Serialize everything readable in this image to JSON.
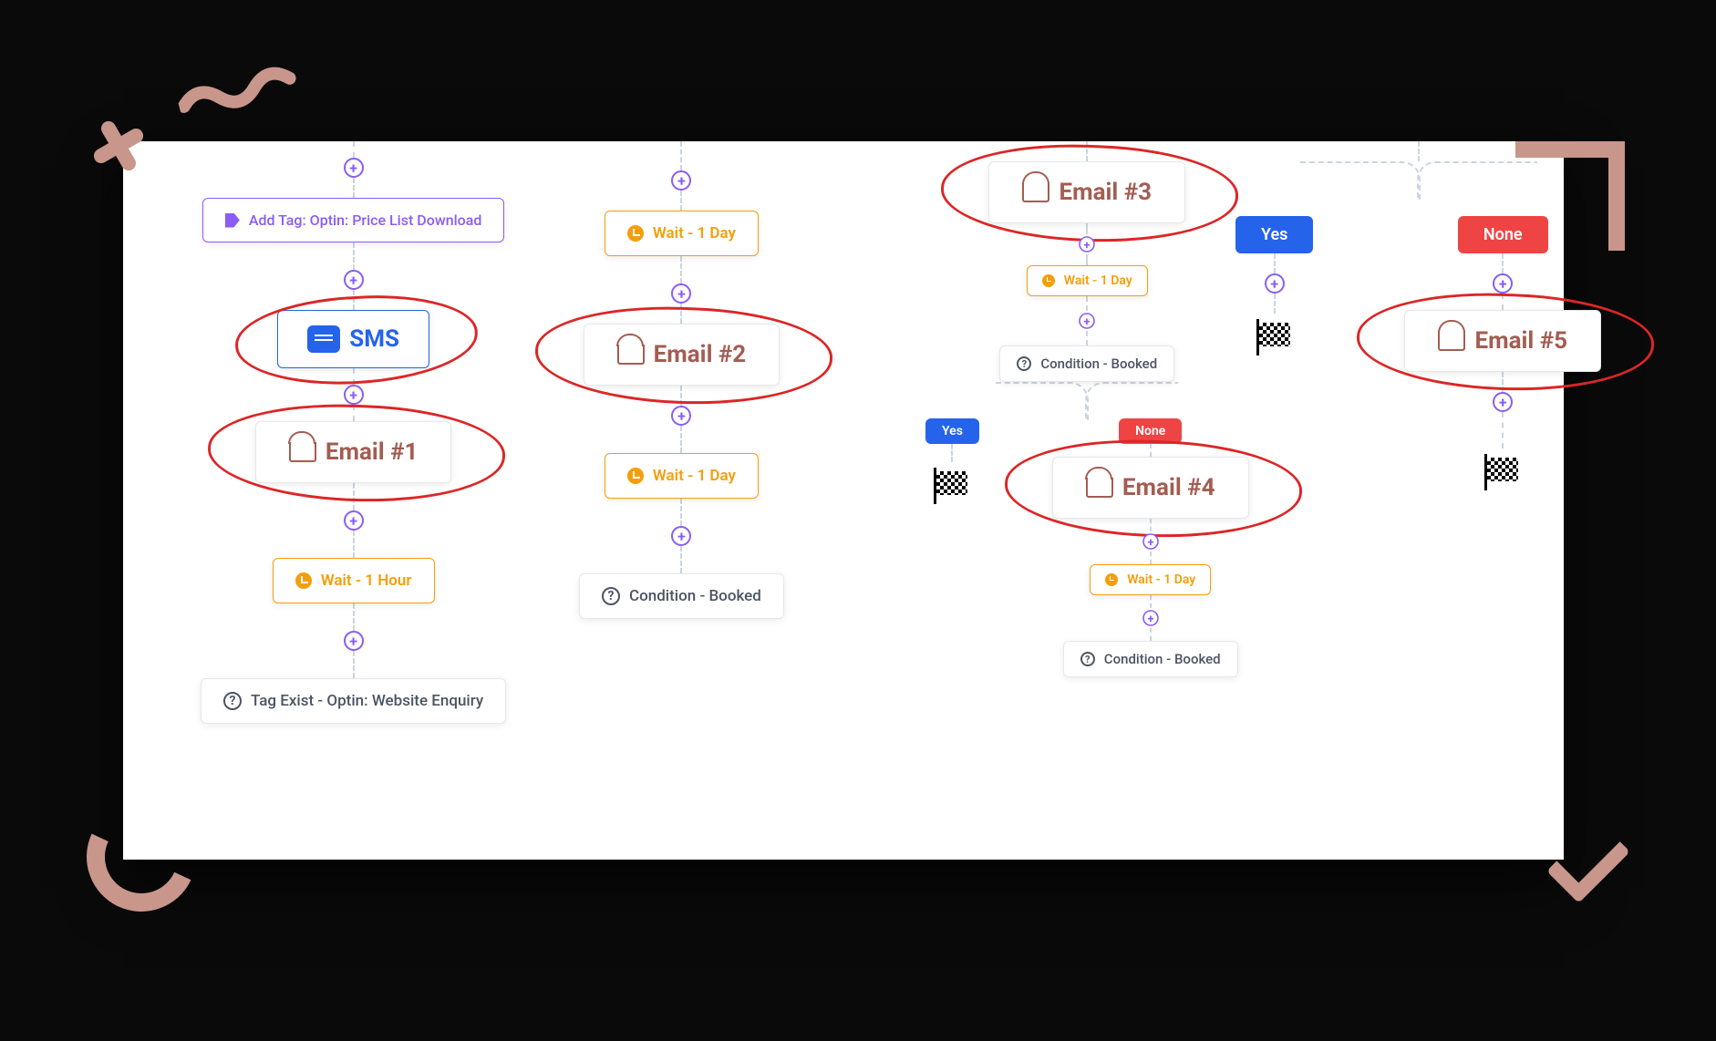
{
  "col1": {
    "addTag": "Add Tag: Optin: Price List Download",
    "sms": "SMS",
    "email1": "Email #1",
    "wait": "Wait - 1 Hour",
    "tagExist": "Tag Exist - Optin: Website Enquiry"
  },
  "col2": {
    "wait1": "Wait - 1 Day",
    "email2": "Email #2",
    "wait2": "Wait - 1 Day",
    "condition": "Condition - Booked"
  },
  "col3": {
    "email3": "Email #3",
    "wait1": "Wait - 1 Day",
    "condition1": "Condition - Booked",
    "yes": "Yes",
    "none": "None",
    "email4": "Email #4",
    "wait2": "Wait - 1 Day",
    "condition2": "Condition - Booked"
  },
  "col4": {
    "yes": "Yes",
    "none": "None",
    "email5": "Email #5"
  }
}
